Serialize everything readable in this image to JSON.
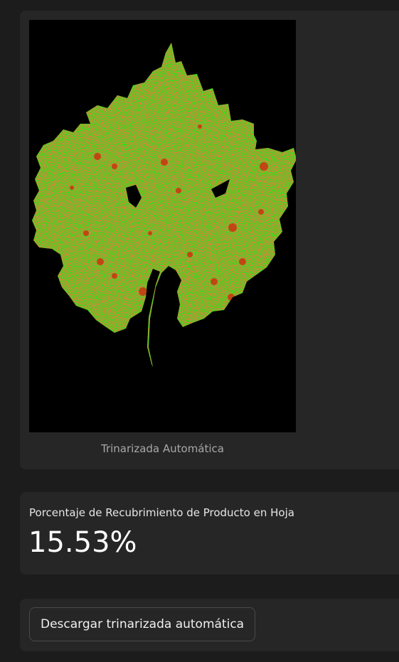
{
  "image_card": {
    "caption": "Trinarizada Automática",
    "image": {
      "name": "trinarized-leaf",
      "colors": {
        "background": "#000000",
        "leaf": "#00ff00",
        "product": "#d03010"
      }
    }
  },
  "metric": {
    "label": "Porcentaje de Recubrimiento de Producto en Hoja",
    "value": "15.53%"
  },
  "download": {
    "button_label": "Descargar trinarizada automática"
  }
}
